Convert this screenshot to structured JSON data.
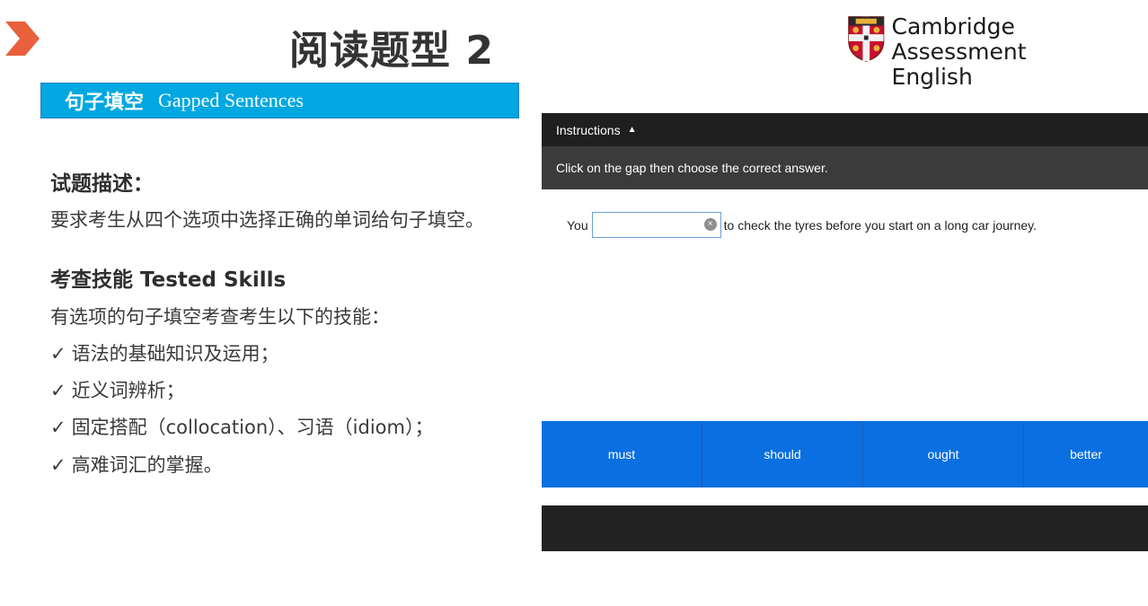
{
  "slide": {
    "title": "阅读题型 2",
    "banner_zh": "句子填空",
    "banner_en": "Gapped Sentences"
  },
  "logo": {
    "line1": "Cambridge Assessment",
    "line2": "English"
  },
  "content": {
    "desc_heading": "试题描述：",
    "desc_text": "要求考生从四个选项中选择正确的单词给句子填空。",
    "skills_heading": "考查技能 Tested Skills",
    "skills_intro": "有选项的句子填空考查考生以下的技能：",
    "check_mark": "✓",
    "skills": [
      "语法的基础知识及运用；",
      "近义词辨析；",
      "固定搭配（collocation）、习语（idiom）；",
      "高难词汇的掌握。"
    ]
  },
  "app": {
    "instructions_label": "Instructions",
    "instructions_toggle": "▲",
    "instructions_text": "Click on the gap then choose the correct answer.",
    "question_before": "You",
    "gap_value": "",
    "clear_icon": "×",
    "question_after": "to check the tyres before you start on a long car journey.",
    "options": [
      "must",
      "should",
      "ought",
      "better"
    ]
  },
  "colors": {
    "banner": "#00a7e1",
    "options_bg": "#0a6fe0",
    "chevron": "#e8603c",
    "dark_bar": "#1f1f1f"
  }
}
